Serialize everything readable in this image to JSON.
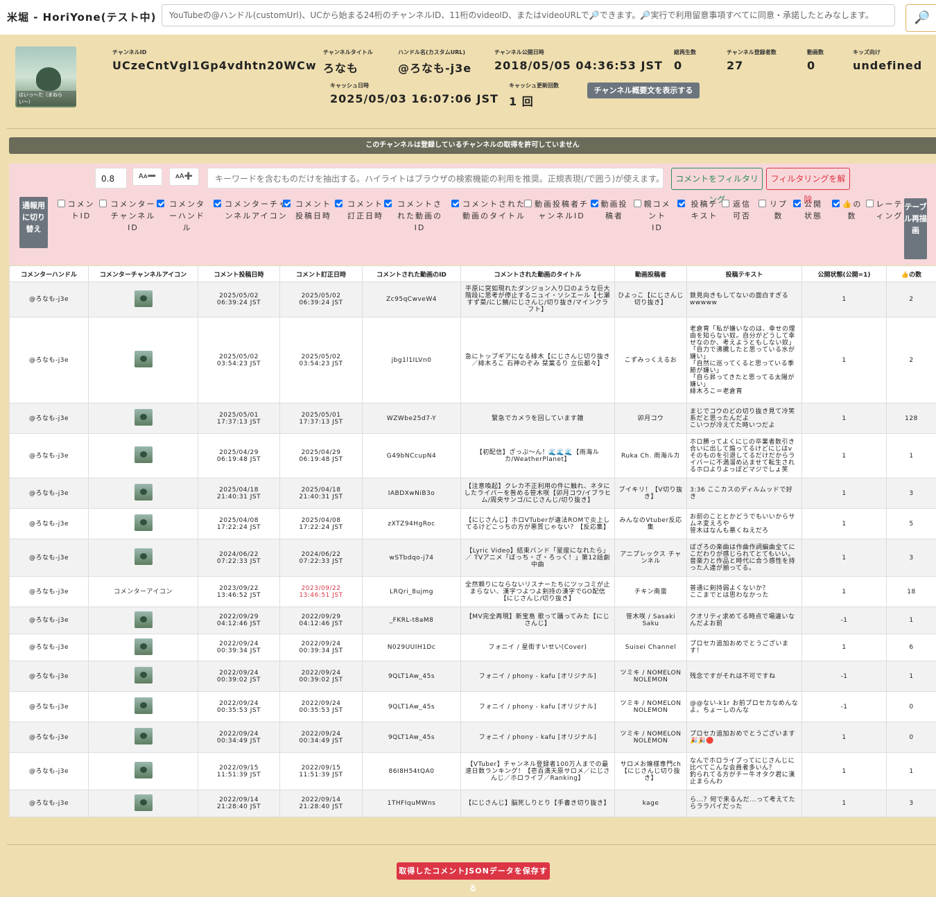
{
  "header": {
    "title": "米堀 - HoriYone(テスト中)",
    "search_placeholder": "YouTubeの@ハンドル(customUrl)、UCから始まる24桁のチャンネルID、11桁のvideoID、またはvideoURLで🔎できます。🔎実行で利用留意事項すべてに同意・承諾したとみなします。",
    "search_icon": "🔎"
  },
  "channel": {
    "avatar_caption": "ほいっ〜た（まねらい〜）",
    "labels": {
      "id": "チャンネルID",
      "title": "チャンネルタイトル",
      "handle": "ハンドル名(カスタムURL)",
      "published": "チャンネル公開日時",
      "views": "総再生数",
      "subscribers": "チャンネル登録者数",
      "videos": "動画数",
      "kids": "キッズ向け",
      "cache_date": "キャッシュ日時",
      "cache_count": "キャッシュ更新回数"
    },
    "values": {
      "id": "UCzeCntVgl1Gp4vdhtn20WCw",
      "title": "ろなも",
      "handle": "@ろなも-j3e",
      "published": "2018/05/05 04:36:53 JST",
      "views": "0",
      "subscribers": "27",
      "videos": "0",
      "kids": "undefined",
      "cache_date": "2025/05/03 16:07:06 JST",
      "cache_count": "1 回"
    },
    "desc_button": "チャンネル概要文を表示する"
  },
  "notice": "このチャンネルは登録しているチャンネルの取得を許可していません",
  "filter": {
    "font_size": "0.8",
    "font_minus": "Aᴀ➖",
    "font_plus": "ᴀA➕",
    "keyword_placeholder": "キーワードを含むものだけを抽出する。ハイライトはブラウザの検索機能の利用を推奨。正規表現(/で囲う)が使えます。(e.g. /(BC|A",
    "filter_button": "コメントをフィルタリング",
    "clear_button": "フィルタリングを解除",
    "report_button": "通報用に切り替え",
    "redraw_button": "テーブル再描画",
    "columns": [
      {
        "label": "コメントID",
        "checked": false
      },
      {
        "label": "コメンターチャンネルID",
        "checked": false
      },
      {
        "label": "コメンターハンドル",
        "checked": true
      },
      {
        "label": "コメンターチャンネルアイコン",
        "checked": true
      },
      {
        "label": "コメント投稿日時",
        "checked": true
      },
      {
        "label": "コメント訂正日時",
        "checked": true
      },
      {
        "label": "コメントされた動画のID",
        "checked": true
      },
      {
        "label": "コメントされた動画のタイトル",
        "checked": true
      },
      {
        "label": "動画投稿者チャンネルID",
        "checked": false
      },
      {
        "label": "動画投稿者",
        "checked": true
      },
      {
        "label": "親コメントID",
        "checked": false
      },
      {
        "label": "投稿テキスト",
        "checked": true
      },
      {
        "label": "返信可否",
        "checked": false
      },
      {
        "label": "リプ数",
        "checked": false
      },
      {
        "label": "公開状態",
        "checked": true
      },
      {
        "label": "👍の数",
        "checked": true
      },
      {
        "label": "レーティング",
        "checked": false
      }
    ]
  },
  "table": {
    "headers": [
      "コメンターハンドル",
      "コメンターチャンネルアイコン",
      "コメント投稿日時",
      "コメント訂正日時",
      "コメントされた動画のID",
      "コメントされた動画のタイトル",
      "動画投稿者",
      "投稿テキスト",
      "公開状態(公開=1)",
      "👍の数"
    ],
    "broken_icon_alt": "コメンターアイコン",
    "rows": [
      {
        "handle": "@ろなも-j3e",
        "posted": "2025/05/02\n06:39:24 JST",
        "edited": "2025/05/02\n06:39:24 JST",
        "edited_red": false,
        "vid": "Zc95qCwveW4",
        "vtitle": "平原に突如現れたダンジョン入り口のような巨大階段に思考が停止するニュイ・ソシエール【七瀬すず菜/にじ鯖/にじさんじ/切り抜き/マインクラフト】",
        "author": "ひよっこ【にじさんじ切り抜き】",
        "text": "鉄見向きもしてないの面白すぎるwwwww",
        "status": "1",
        "likes": "2",
        "icon": true,
        "h": 51
      },
      {
        "handle": "@ろなも-j3e",
        "posted": "2025/05/02\n03:54:23 JST",
        "edited": "2025/05/02\n03:54:23 JST",
        "edited_red": false,
        "vid": "jbg1l1ILVn0",
        "vtitle": "急にトップギアになる緋木【にじさんじ切り抜き／緋木ろこ 石神のぞみ 栞葉るり 立伝都々】",
        "author": "こずみっくえるお",
        "text": "老倉育「私が嫌いなのは、幸せの理由を知らない奴。自分がどうして幸せなのか、考えようともしない奴」\n「自力で沸騰したと思っている水が嫌い」\n「自然に巡ってくると思っている季節が嫌い」\n「自ら昇ってきたと思ってる太陽が嫌い」\n緋木ろこ＝老倉育",
        "status": "1",
        "likes": "2",
        "icon": true,
        "h": 124
      },
      {
        "handle": "@ろなも-j3e",
        "posted": "2025/05/01\n17:37:13 JST",
        "edited": "2025/05/01\n17:37:13 JST",
        "edited_red": false,
        "vid": "WZWbe25d7-Y",
        "vtitle": "緊急でカメラを回しています雑",
        "author": "卯月コウ",
        "text": "まじでコウのどの切り抜き見て冷笑系だと思ったんだよ\nこいつが冷えてた時いつだよ",
        "status": "1",
        "likes": "128",
        "icon": true,
        "h": 44
      },
      {
        "handle": "@ろなも-j3e",
        "posted": "2025/04/29\n06:19:48 JST",
        "edited": "2025/04/29\n06:19:48 JST",
        "edited_red": false,
        "vid": "G49bNCcupN4",
        "vtitle": "【初配信】ざっぷ～ん！🌊🌊🌊【雨海ルカ/WeatherPlanet】",
        "author": "Ruka Ch. 雨海ルカ",
        "text": "ホロ勝ってよくにじの卒業者数引き合いに出して煽ってるけどにじはvそのものを引退してるだけだからライバーに不満溜め込ませて転生されるホロよりよっぽどマジでしょ笑",
        "status": "1",
        "likes": "1",
        "icon": true,
        "h": 64
      },
      {
        "handle": "@ろなも-j3e",
        "posted": "2025/04/18\n21:40:31 JST",
        "edited": "2025/04/18\n21:40:31 JST",
        "edited_red": false,
        "vid": "IABDXwNiB3o",
        "vtitle": "【注意喚起】クレカ不正利用の件に触れ、ネタにしたライバーを咎める笹木咲【卯月コウ/イブラヒム/周央サンゴ/にじさんじ/切り抜き】",
        "author": "ブイキリ！【V切り抜き】",
        "text": "3:36 ここカスのディルムッドで好き",
        "status": "1",
        "likes": "3",
        "icon": true,
        "h": 44
      },
      {
        "handle": "@ろなも-j3e",
        "posted": "2025/04/08\n17:22:24 JST",
        "edited": "2025/04/08\n17:22:24 JST",
        "edited_red": false,
        "vid": "zXTZ94HgRoc",
        "vtitle": "【にじさんじ】ホロVTuberが違法ROMで炎上してるけどこっちの方が悪質じゃない？【反応集】",
        "author": "みんなのVtuber反応集",
        "text": "お前のこととかどうでもいいからサムネ変えろや\n笹木はなんも悪くねえだろ",
        "status": "1",
        "likes": "5",
        "icon": true,
        "h": 44
      },
      {
        "handle": "@ろなも-j3e",
        "posted": "2024/06/22\n07:22:33 JST",
        "edited": "2024/06/22\n07:22:33 JST",
        "edited_red": false,
        "vid": "wSTbdqo-j74",
        "vtitle": "【Lyric Video】結束バンド「星座になれたら」／ TVアニメ「ぼっち・ざ・ろっく！」第12話劇中曲",
        "author": "アニプレックス チャンネル",
        "text": "ぼざろの楽曲は作曲作詞編曲全てにこだわりが感じられてとてもいい。音楽力と作品と時代に合う感性を持った人達が揃ってる。",
        "status": "1",
        "likes": "3",
        "icon": true,
        "h": 54
      },
      {
        "handle": "@ろなも-j3e",
        "posted": "2023/09/22\n13:46:52 JST",
        "edited": "2023/09/22\n13:46:51 JST",
        "edited_red": true,
        "vid": "LRQri_8ujmg",
        "vtitle": "全然頼りにならないリスナーたちにツッコミが止まらない、漢字つよつよ剣持の漢字でGO配信【にじさんじ/切り抜き】",
        "author": "チキン南蛮",
        "text": "普通に剣持弱よくないか？\nここまでとは思わなかった",
        "status": "1",
        "likes": "18",
        "icon": false,
        "h": 44
      },
      {
        "handle": "@ろなも-j3e",
        "posted": "2022/09/29\n04:12:46 JST",
        "edited": "2022/09/29\n04:12:46 JST",
        "edited_red": false,
        "vid": "_FKRL-t8aM8",
        "vtitle": "【MV完全再現】新宝島 歌って踊ってみた【にじさんじ】",
        "author": "笹木咲 / Sasaki Saku",
        "text": "クオリティ求めてる時点で場違いなんだよお前",
        "status": "-1",
        "likes": "1",
        "icon": true,
        "h": 39
      },
      {
        "handle": "@ろなも-j3e",
        "posted": "2022/09/24\n00:39:34 JST",
        "edited": "2022/09/24\n00:39:34 JST",
        "edited_red": false,
        "vid": "N029UUIH1Dc",
        "vtitle": "フォニイ / 星街すいせい(Cover)",
        "author": "Suisei Channel",
        "text": "プロセカ追加おめでとうございます！",
        "status": "1",
        "likes": "6",
        "icon": true,
        "h": 39
      },
      {
        "handle": "@ろなも-j3e",
        "posted": "2022/09/24\n00:39:02 JST",
        "edited": "2022/09/24\n00:39:02 JST",
        "edited_red": false,
        "vid": "9QLT1Aw_45s",
        "vtitle": "フォニイ / phony - kafu [オリジナル]",
        "author": "ツミキ / NOMELON NOLEMON",
        "text": "残念ですがそれは不可ですね",
        "status": "-1",
        "likes": "1",
        "icon": true,
        "h": 44
      },
      {
        "handle": "@ろなも-j3e",
        "posted": "2022/09/24\n00:35:53 JST",
        "edited": "2022/09/24\n00:35:53 JST",
        "edited_red": false,
        "vid": "9QLT1Aw_45s",
        "vtitle": "フォニイ / phony - kafu [オリジナル]",
        "author": "ツミキ / NOMELON NOLEMON",
        "text": "@@ない-k1r お前プロセカなめんなよ。ちょーしのんな",
        "status": "-1",
        "likes": "0",
        "icon": true,
        "h": 44
      },
      {
        "handle": "@ろなも-j3e",
        "posted": "2022/09/24\n00:34:49 JST",
        "edited": "2022/09/24\n00:34:49 JST",
        "edited_red": false,
        "vid": "9QLT1Aw_45s",
        "vtitle": "フォニイ / phony - kafu [オリジナル]",
        "author": "ツミキ / NOMELON NOLEMON",
        "text": "プロセカ追加おめでとうございます🎉🎉🔴",
        "status": "1",
        "likes": "0",
        "icon": true,
        "h": 44
      },
      {
        "handle": "@ろなも-j3e",
        "posted": "2022/09/15\n11:51:39 JST",
        "edited": "2022/09/15\n11:51:39 JST",
        "edited_red": false,
        "vid": "86I8H54tQA0",
        "vtitle": "【VTuber】チャンネル登録者100万人までの最速日数ランキング！【壱百満天原サロメ／にじさんじ／ホロライブ／Ranking】",
        "author": "サロメお嬢様専門ch【にじさんじ切り抜き】",
        "text": "なんでホロライブってにじさんじに比べてこんな会員者多いん？\n釣られてる方がチー牛オタク君に漢止まらんわ",
        "status": "1",
        "likes": "1",
        "icon": true,
        "h": 54
      },
      {
        "handle": "@ろなも-j3e",
        "posted": "2022/09/14\n21:28:40 JST",
        "edited": "2022/09/14\n21:28:40 JST",
        "edited_red": false,
        "vid": "1THFIquMWns",
        "vtitle": "【にじさんじ】脳死しりとり【手書き切り抜き】",
        "author": "kage",
        "text": "ら...？何で来るんだ...って考えてたらララバイだった",
        "status": "1",
        "likes": "3",
        "icon": true,
        "h": 39
      }
    ]
  },
  "save_button": "取得したコメントJSONデータを保存する"
}
